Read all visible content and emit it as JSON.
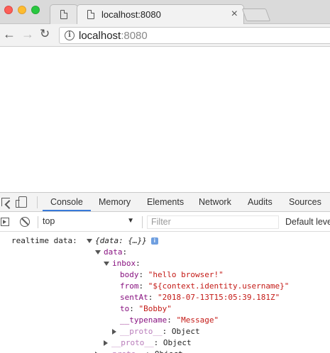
{
  "browser": {
    "active_tab_title": "localhost:8080",
    "tab_close_glyph": "×",
    "url_host": "localhost",
    "url_port": ":8080"
  },
  "devtools": {
    "tabs": [
      "Console",
      "Memory",
      "Elements",
      "Network",
      "Audits",
      "Sources"
    ],
    "active_tab": "Console",
    "context_value": "top",
    "filter_placeholder": "Filter",
    "levels_label": "Default levels"
  },
  "console": {
    "log_label": "realtime data:",
    "root_preview": "{data: {…}}",
    "info_badge": "i",
    "data_key": "data",
    "inbox_key": "inbox",
    "fields": [
      {
        "key": "body",
        "value": "\"hello browser!\""
      },
      {
        "key": "from",
        "value": "\"${context.identity.username}\""
      },
      {
        "key": "sentAt",
        "value": "\"2018-07-13T15:05:39.181Z\""
      },
      {
        "key": "to",
        "value": "\"Bobby\""
      },
      {
        "key": "__typename",
        "value": "\"Message\""
      }
    ],
    "proto_key": "__proto__",
    "proto_value": "Object"
  }
}
